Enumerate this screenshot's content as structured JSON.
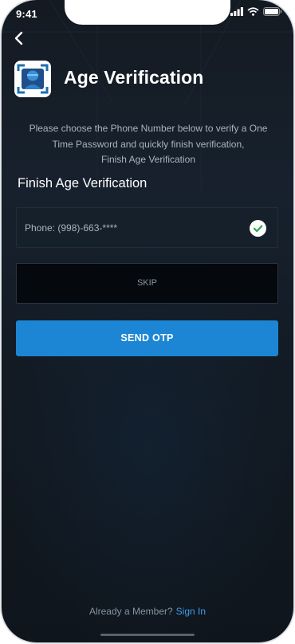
{
  "status_bar": {
    "time": "9:41"
  },
  "header": {
    "title": "Age Verification"
  },
  "description": {
    "line1": "Please choose the Phone Number below to verify a One",
    "line2": "Time Password and quickly finish verification,",
    "line3": "Finish Age Verification"
  },
  "section": {
    "title": "Finish Age Verification"
  },
  "phone_option": {
    "label": "Phone: (998)-663-****",
    "selected": true
  },
  "buttons": {
    "skip_label": "SKIP",
    "send_otp_label": "SEND OTP"
  },
  "footer": {
    "prompt": "Already a Member?",
    "sign_in_label": "Sign In"
  },
  "colors": {
    "background": "#141a22",
    "accent": "#1c86d4",
    "link": "#3f9ee8",
    "check": "#2aaa4a"
  },
  "icons": {
    "back": "chevron-left-icon",
    "app": "face-scan-icon",
    "selected": "check-circle-icon"
  }
}
